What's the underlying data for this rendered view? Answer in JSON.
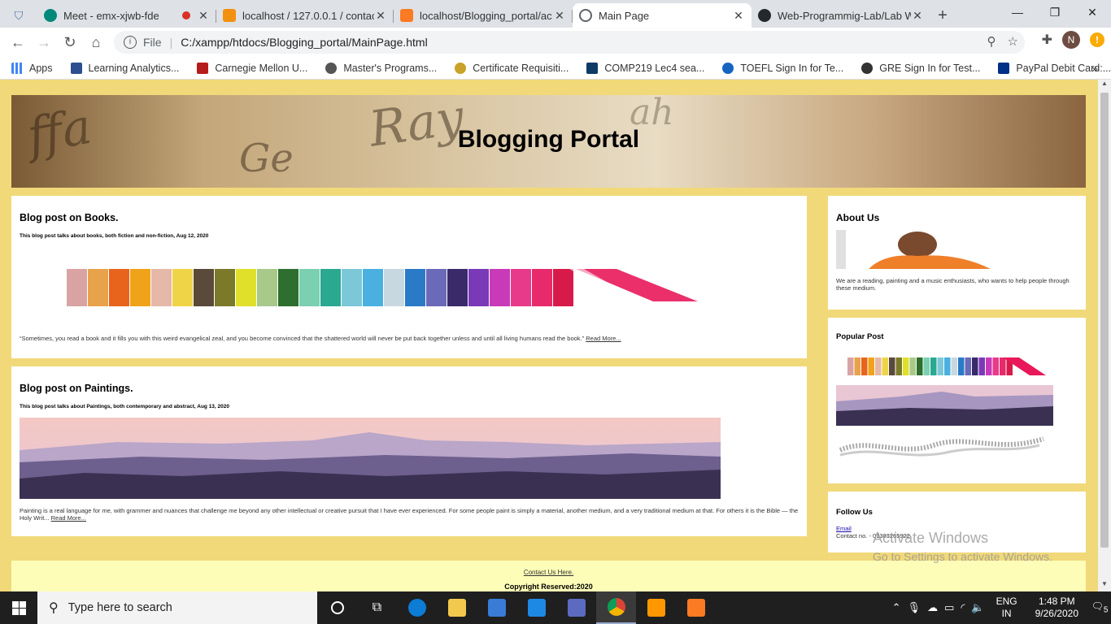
{
  "browser": {
    "tabs": [
      {
        "label": "Meet - emx-xjwb-fde",
        "favicon_color": "#00897b",
        "recording": true
      },
      {
        "label": "localhost / 127.0.0.1 / contact",
        "favicon_color": "#f29111"
      },
      {
        "label": "localhost/Blogging_portal/ac",
        "favicon_color": "#fb7a24"
      },
      {
        "label": "Main Page",
        "favicon_color": "#5f6368",
        "active": true
      },
      {
        "label": "Web-Programmig-Lab/Lab W",
        "favicon_color": "#24292e"
      }
    ],
    "new_tab_label": "+",
    "window_controls": {
      "minimize": "—",
      "maximize": "❐",
      "close": "✕"
    },
    "address": {
      "scheme_label": "File",
      "url": "C:/xampp/htdocs/Blogging_portal/MainPage.html"
    },
    "profile_initial": "N",
    "bookmarks": [
      {
        "label": "Apps",
        "color": "#4285f4"
      },
      {
        "label": "Learning Analytics...",
        "color": "#2e4f8f"
      },
      {
        "label": "Carnegie Mellon U...",
        "color": "#b71c1c"
      },
      {
        "label": "Master's Programs...",
        "color": "#555555"
      },
      {
        "label": "Certificate Requisiti...",
        "color": "#c9a227"
      },
      {
        "label": "COMP219 Lec4 sea...",
        "color": "#0d3b66"
      },
      {
        "label": "TOEFL Sign In for Te...",
        "color": "#1565c0"
      },
      {
        "label": "GRE Sign In for Test...",
        "color": "#333333"
      },
      {
        "label": "PayPal Debit Card:...",
        "color": "#003087"
      }
    ],
    "bookmarks_more": "»"
  },
  "page": {
    "title": "Blogging Portal",
    "posts": [
      {
        "title": "Blog post on Books.",
        "subtitle": "This blog post talks about books, both fiction and non-fiction, Aug 12, 2020",
        "excerpt": "“Sometimes, you read a book and it fills you with this weird evangelical zeal, and you become convinced that the shattered world will never be put back together unless and until all living humans read the book.”",
        "read_more": "Read More..."
      },
      {
        "title": "Blog post on Paintings.",
        "subtitle": "This blog post talks about Paintings, both contemporary and abstract, Aug 13, 2020",
        "excerpt": "Painting is a real language for me, with grammer and nuances that challenge me beyond any other intellectual or creative pursuit that I have ever experienced. For some people paint is simply a material, another medium, and a very traditional medium at that. For others it is the Bible — the Holy Writ...",
        "read_more": "Read More..."
      }
    ],
    "sidebar": {
      "about": {
        "title": "About Us",
        "text": "We are a reading, painting and a music enthusiasts, who wants to help people through these medium."
      },
      "popular": {
        "title": "Popular Post"
      },
      "follow": {
        "title": "Follow Us",
        "email_label": "Email",
        "contact": "Contact no. - 01383265922"
      }
    },
    "footer": {
      "contact_link": "Contact Us Here.",
      "copyright": "Copyright Reserved:2020"
    }
  },
  "watermark": {
    "line1": "Activate Windows",
    "line2": "Go to Settings to activate Windows."
  },
  "taskbar": {
    "search_placeholder": "Type here to search",
    "lang": "ENG",
    "region": "IN",
    "time": "1:48 PM",
    "date": "9/26/2020",
    "notifications": "5"
  },
  "colors": {
    "page_bg": "#f1d979",
    "footer_bg": "#fdfdb8",
    "card_bg": "#ffffff"
  }
}
